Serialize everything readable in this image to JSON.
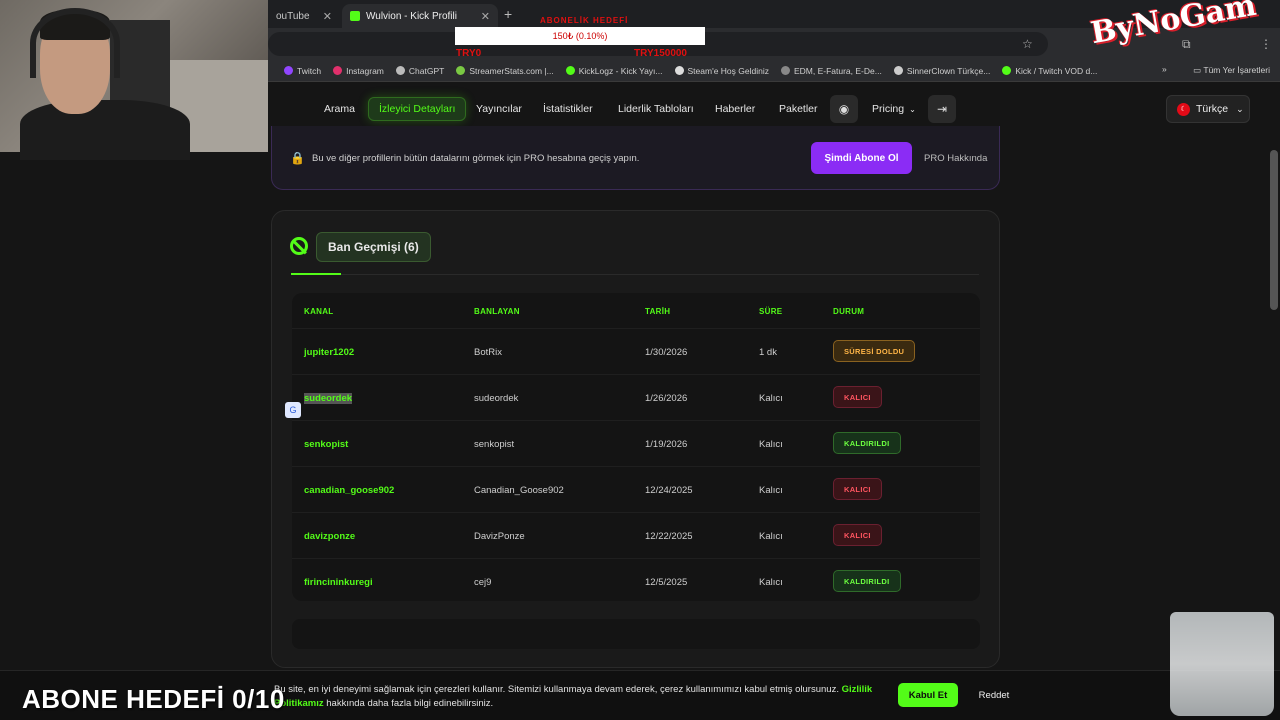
{
  "browser": {
    "tabs": [
      {
        "title": "ouTube"
      },
      {
        "title": "Wulvion - Kick Profili"
      }
    ],
    "bookmarks": [
      "Twitch",
      "Instagram",
      "ChatGPT",
      "StreamerStats.com |...",
      "KickLogz - Kick Yayı...",
      "Steam'e Hoş Geldiniz",
      "EDM, E-Fatura, E-De...",
      "SinnerClown Türkçe...",
      "Kick / Twitch VOD d..."
    ],
    "bookmarks_right": "Tüm Yer İşaretleri",
    "more_bookmarks": "»"
  },
  "overlay": {
    "goal_title": "ABONELİK HEDEFİ",
    "goal_progress": "150₺ (0.10%)",
    "goal_left": "TRY0",
    "goal_right": "TRY150000",
    "brand": "ByNoGam",
    "sub_goal": "ABONE HEDEFİ 0/10"
  },
  "nav": {
    "items": [
      "Arama",
      "İzleyici Detayları",
      "Yayıncılar",
      "İstatistikler",
      "Liderlik Tabloları",
      "Haberler",
      "Paketler"
    ],
    "pricing": "Pricing",
    "language": "Türkçe"
  },
  "pro_banner": {
    "message": "Bu ve diğer profillerin bütün datalarını görmek için PRO hesabına geçiş yapın.",
    "subscribe": "Şimdi Abone Ol",
    "about": "PRO Hakkında"
  },
  "ban_history": {
    "title": "Ban Geçmişi (6)",
    "columns": [
      "KANAL",
      "BANLAYAN",
      "TARİH",
      "SÜRE",
      "DURUM"
    ],
    "rows": [
      {
        "kanal": "jupiter1202",
        "banlayan": "BotRix",
        "tarih": "1/30/2026",
        "sure": "1 dk",
        "durum": "SÜRESİ DOLDU",
        "status": "expired"
      },
      {
        "kanal": "sudeordek",
        "banlayan": "sudeordek",
        "tarih": "1/26/2026",
        "sure": "Kalıcı",
        "durum": "KALICI",
        "status": "perm"
      },
      {
        "kanal": "senkopist",
        "banlayan": "senkopist",
        "tarih": "1/19/2026",
        "sure": "Kalıcı",
        "durum": "KALDIRILDI",
        "status": "removed"
      },
      {
        "kanal": "canadian_goose902",
        "banlayan": "Canadian_Goose902",
        "tarih": "12/24/2025",
        "sure": "Kalıcı",
        "durum": "KALICI",
        "status": "perm"
      },
      {
        "kanal": "davizponze",
        "banlayan": "DavizPonze",
        "tarih": "12/22/2025",
        "sure": "Kalıcı",
        "durum": "KALICI",
        "status": "perm"
      },
      {
        "kanal": "firincininkuregi",
        "banlayan": "cej9",
        "tarih": "12/5/2025",
        "sure": "Kalıcı",
        "durum": "KALDIRILDI",
        "status": "removed"
      }
    ]
  },
  "cookie": {
    "text": "Bu site, en iyi deneyimi sağlamak için çerezleri kullanır. Sitemizi kullanmaya devam ederek, çerez kullanımımızı kabul etmiş olursunuz.",
    "link": "Gizlilik Politikamız",
    "text_after": "hakkında daha fazla bilgi edinebilirsiniz.",
    "accept": "Kabul Et",
    "reject": "Reddet"
  },
  "colors": {
    "accent": "#53fc18",
    "pro": "#8b2cf5"
  }
}
